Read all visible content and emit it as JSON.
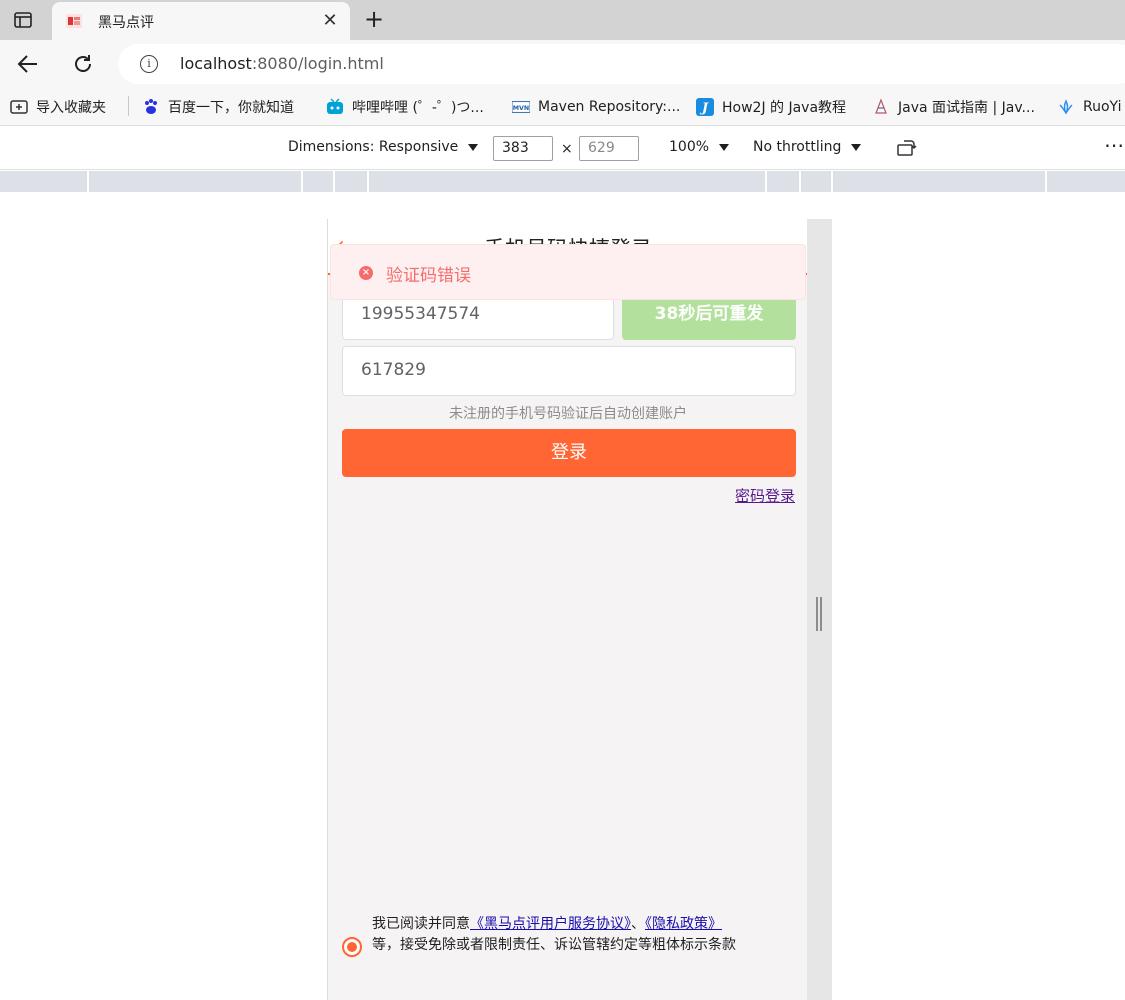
{
  "browser": {
    "tab_title": "黑马点评",
    "url_host": "localhost",
    "url_rest": ":8080/login.html",
    "bookmarks": [
      {
        "label": "导入收藏夹",
        "icon": "import-icon"
      },
      {
        "label": "百度一下，你就知道",
        "icon": "baidu-icon"
      },
      {
        "label": "哔哩哔哩 (゜-゜)つ...",
        "icon": "bilibili-icon"
      },
      {
        "label": "Maven Repository:...",
        "icon": "maven-icon"
      },
      {
        "label": "How2J 的 Java教程",
        "icon": "how2j-icon"
      },
      {
        "label": "Java 面试指南 | Jav...",
        "icon": "java-guide-icon"
      },
      {
        "label": "RuoYi",
        "icon": "ruoyi-icon"
      }
    ]
  },
  "devtools": {
    "dimensions_label": "Dimensions: Responsive",
    "width_value": "383",
    "times": "×",
    "height_value": "629",
    "zoom": "100%",
    "throttling": "No throttling"
  },
  "page": {
    "title": "手机号码快捷登录",
    "toast": "验证码错误",
    "phone_value": "19955347574",
    "resend_label": "38秒后可重发",
    "code_value": "617829",
    "hint": "未注册的手机号码验证后自动创建账户",
    "login_label": "登录",
    "password_login_label": "密码登录",
    "agreement": {
      "prefix": "我已阅读并同意",
      "service_link": "《黑马点评用户服务协议》",
      "separator": "、",
      "privacy_link": "《隐私政策》",
      "suffix": "等，接受免除或者限制责任、诉讼管辖约定等粗体标示条款"
    }
  },
  "colors": {
    "accent": "#ff6633",
    "error": "#f56c6c",
    "resend_disabled": "#b3e19d"
  }
}
